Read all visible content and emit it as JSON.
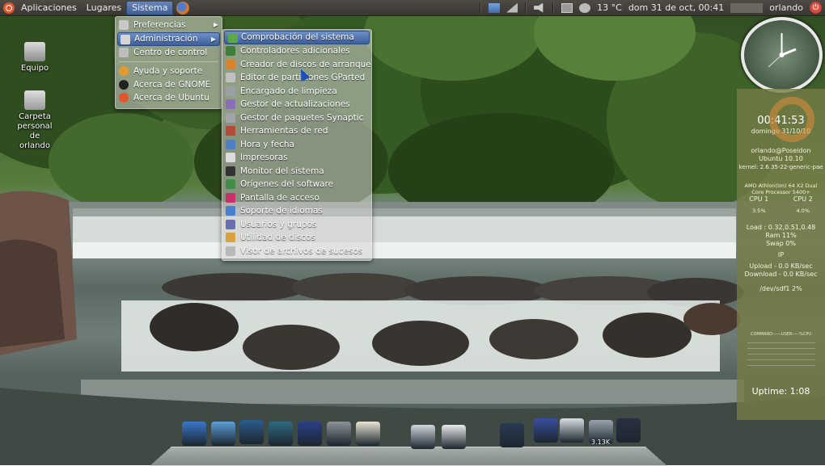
{
  "top_panel": {
    "menus": [
      "Aplicaciones",
      "Lugares",
      "Sistema"
    ],
    "active_menu": "Sistema",
    "temperature": "13 °C",
    "datetime": "dom 31 de oct, 00:41",
    "user": "orlando"
  },
  "desktop_icons": [
    {
      "label": "Equipo"
    },
    {
      "label": "Carpeta personal de orlando"
    }
  ],
  "sistema_menu": {
    "items": [
      {
        "label": "Preferencias",
        "submenu": true,
        "icon": "preferences-icon"
      },
      {
        "label": "Administración",
        "submenu": true,
        "icon": "administration-icon",
        "highlighted": true
      },
      {
        "label": "Centro de control",
        "icon": "control-center-icon"
      },
      {
        "label": "Ayuda y soporte",
        "icon": "help-icon"
      },
      {
        "label": "Acerca de GNOME",
        "icon": "gnome-icon"
      },
      {
        "label": "Acerca de Ubuntu",
        "icon": "ubuntu-icon"
      }
    ]
  },
  "admin_menu": {
    "items": [
      {
        "label": "Comprobación del sistema",
        "highlighted": true,
        "color": "#5ba84a"
      },
      {
        "label": "Controladores adicionales",
        "color": "#3f7d3a"
      },
      {
        "label": "Creador de discos de arranque",
        "color": "#d9822b"
      },
      {
        "label": "Editor de particiones GParted",
        "color": "#c0c0c0"
      },
      {
        "label": "Encargado de limpieza",
        "color": "#9aa0a6"
      },
      {
        "label": "Gestor de actualizaciones",
        "color": "#8a6fb8"
      },
      {
        "label": "Gestor de paquetes Synaptic",
        "color": "#a0a4a8"
      },
      {
        "label": "Herramientas de red",
        "color": "#b44a3a"
      },
      {
        "label": "Hora y fecha",
        "color": "#4f7fc4"
      },
      {
        "label": "Impresoras",
        "color": "#dcdcdc"
      },
      {
        "label": "Monitor del sistema",
        "color": "#333333"
      },
      {
        "label": "Orígenes del software",
        "color": "#3f8f4a"
      },
      {
        "label": "Pantalla de acceso",
        "color": "#c8306a"
      },
      {
        "label": "Soporte de idiomas",
        "color": "#4a7fd0"
      },
      {
        "label": "Usuarios y grupos",
        "color": "#6a6fb0"
      },
      {
        "label": "Utilidad de discos",
        "color": "#d9a040"
      },
      {
        "label": "Visor de archivos de sucesos",
        "color": "#b9b9b9"
      }
    ]
  },
  "conky": {
    "time": "00:41:53",
    "date": "domingo 31/10/10",
    "host": "orlando@Poseidon",
    "os": "Ubuntu 10.10",
    "kernel": "kernel: 2.6.35-22-generic-pae",
    "cpu_model": "AMD Athlon(tm) 64 X2 Dual Core Processor 5400+",
    "cpu1_label": "CPU 1",
    "cpu2_label": "CPU 2",
    "cpu1_val": "3.5%",
    "cpu2_val": "4.0%",
    "load": "Load : 0.32,0.51,0.48",
    "ram": "Ram 11%",
    "swap": "Swap 0%",
    "ip": "IP",
    "upload": "Upload - 0.0 KB/sec",
    "download": "Download - 0.0 KB/sec",
    "disk": "/dev/sdf1 2%",
    "proc_header": "COMMAND------USER-----%CPU",
    "uptime": "Uptime: 1:08"
  },
  "dock": {
    "items": [
      "finder-icon",
      "safari-icon",
      "time-machine-icon",
      "activity-monitor-icon",
      "clapper-icon",
      "calculator-icon",
      "textedit-icon",
      "preview-icon",
      "calendar-icon",
      "terminal-icon",
      "phone-icon",
      "mail-icon",
      "weather-icon",
      "pointer-icon"
    ],
    "weather_label": "3.13K"
  }
}
